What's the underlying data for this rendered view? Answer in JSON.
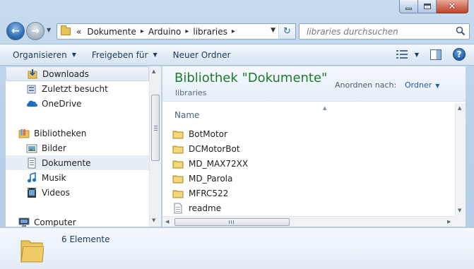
{
  "window": {
    "controls": {
      "minimize_icon": "minimize-icon",
      "maximize_icon": "maximize-icon",
      "close_symbol": "✕"
    }
  },
  "navigation": {
    "back_symbol": "←",
    "forward_symbol": "→",
    "history_dropdown_symbol": "▼",
    "breadcrumb_overflow": "«",
    "breadcrumbs": [
      "Dokumente",
      "Arduino",
      "libraries"
    ],
    "breadcrumb_separator": "▸",
    "address_dropdown_symbol": "▼",
    "refresh_symbol": "↻",
    "search_placeholder": "libraries durchsuchen"
  },
  "toolbar": {
    "organize": "Organisieren",
    "share": "Freigeben für",
    "new_folder": "Neuer Ordner",
    "caret": "▼",
    "help": "?"
  },
  "sidebar": {
    "items": [
      {
        "label": "Downloads",
        "icon": "downloads-icon",
        "selected": true
      },
      {
        "label": "Zuletzt besucht",
        "icon": "recent-places-icon"
      },
      {
        "label": "OneDrive",
        "icon": "onedrive-icon"
      },
      {
        "label": "Bibliotheken",
        "icon": "libraries-icon"
      },
      {
        "label": "Bilder",
        "icon": "pictures-icon"
      },
      {
        "label": "Dokumente",
        "icon": "documents-icon",
        "hover": true
      },
      {
        "label": "Musik",
        "icon": "music-icon"
      },
      {
        "label": "Videos",
        "icon": "videos-icon"
      },
      {
        "label": "Computer",
        "icon": "computer-icon"
      }
    ]
  },
  "library": {
    "title": "Bibliothek \"Dokumente\"",
    "subtitle": "libraries",
    "arrange_label": "Anordnen nach:",
    "arrange_value": "Ordner",
    "arrange_caret": "▼"
  },
  "file_list": {
    "column_name": "Name",
    "sort_symbol": "▲",
    "items": [
      {
        "name": "BotMotor",
        "icon": "folder-icon"
      },
      {
        "name": "DCMotorBot",
        "icon": "folder-icon"
      },
      {
        "name": "MD_MAX72XX",
        "icon": "folder-icon"
      },
      {
        "name": "MD_Parola",
        "icon": "folder-icon"
      },
      {
        "name": "MFRC522",
        "icon": "folder-icon"
      },
      {
        "name": "readme",
        "icon": "text-file-icon"
      }
    ]
  },
  "scrollbars": {
    "left": "◀",
    "right": "▶",
    "up": "▲",
    "down": "▼"
  },
  "details": {
    "count": "6 Elemente"
  },
  "colors": {
    "library_title": "#1e7a2c",
    "link_blue": "#1d5aa8",
    "accent": "#b9d1ea"
  }
}
